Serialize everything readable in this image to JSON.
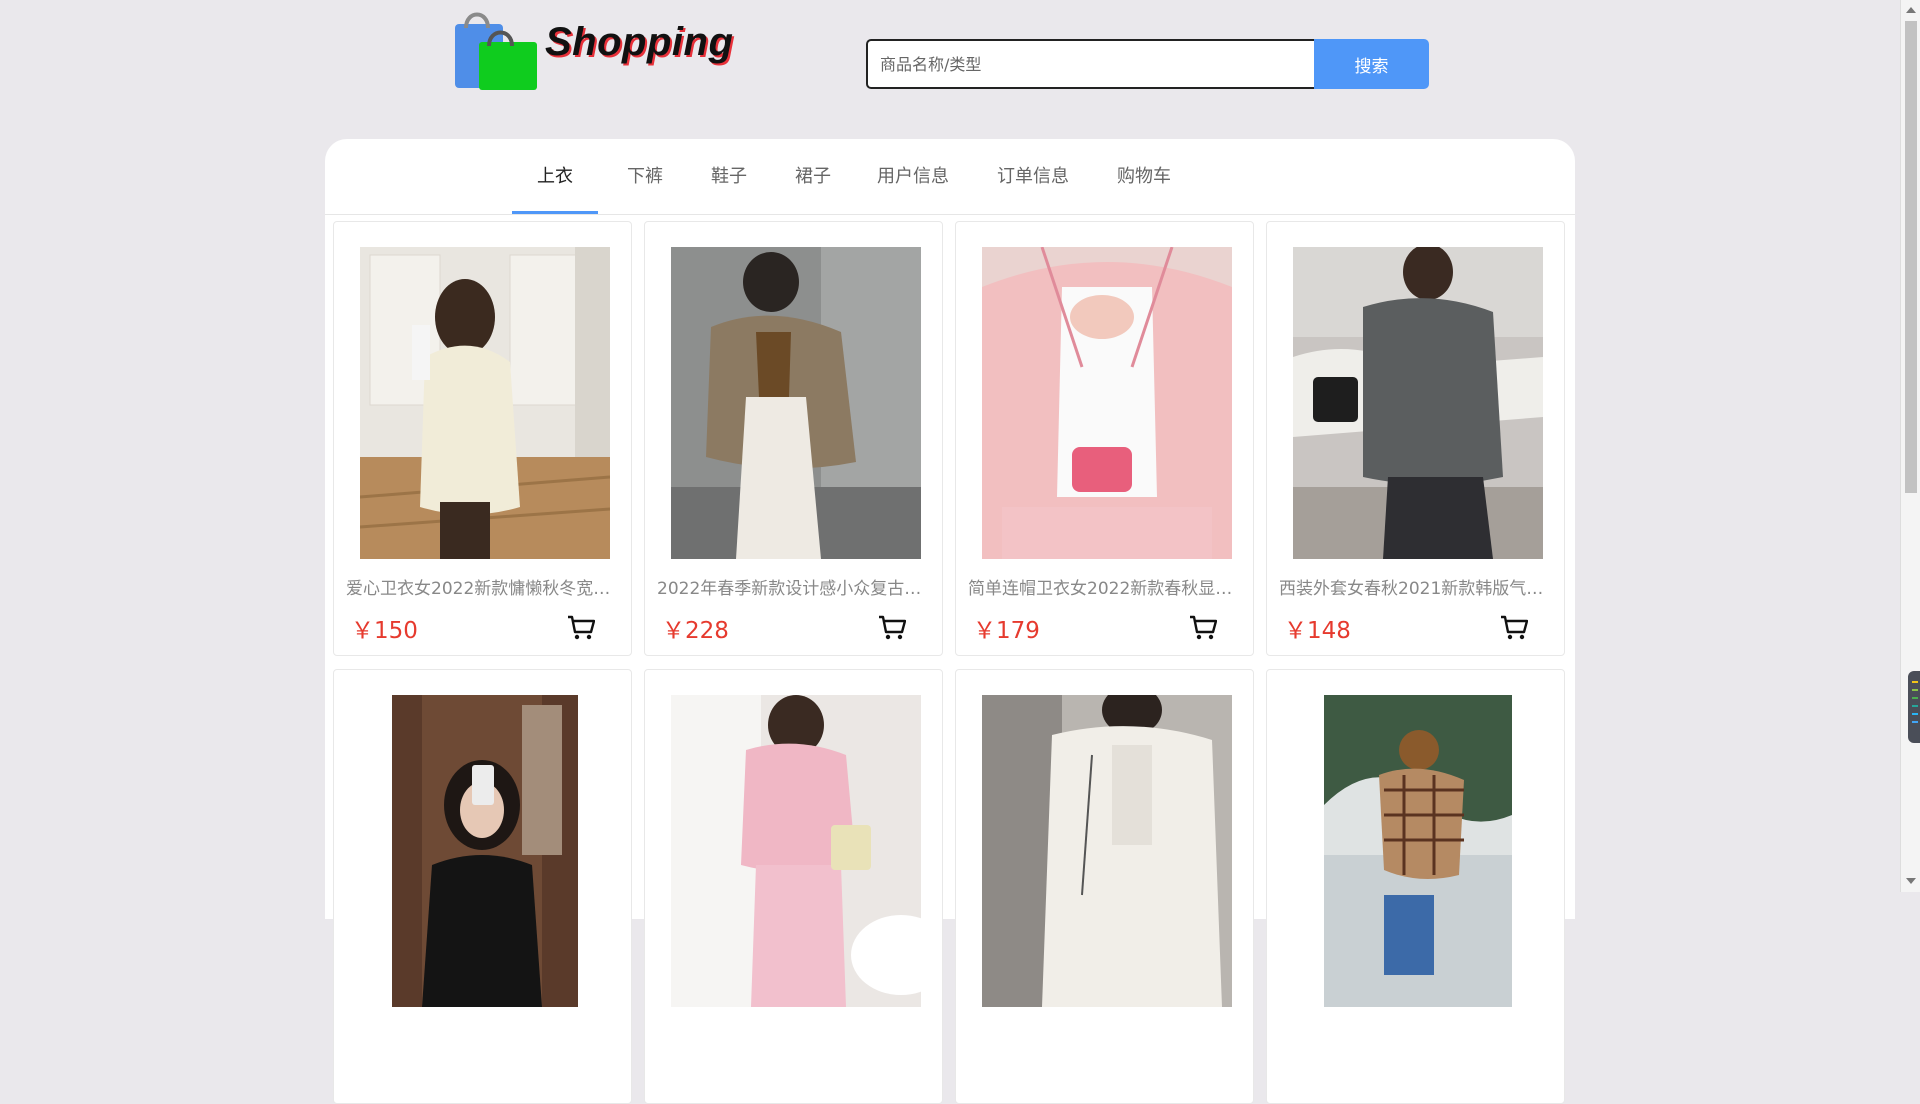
{
  "header": {
    "brand": "Shopping",
    "search_placeholder": "商品名称/类型",
    "search_button": "搜索"
  },
  "tabs": [
    "上衣",
    "下裤",
    "鞋子",
    "裙子",
    "用户信息",
    "订单信息",
    "购物车"
  ],
  "active_tab": "上衣",
  "products": [
    {
      "title": "爱心卫衣女2022新款慵懒秋冬宽松...",
      "price": "￥150"
    },
    {
      "title": "2022年春季新款设计感小众复古格...",
      "price": "￥228"
    },
    {
      "title": "简单连帽卫衣女2022新款春秋显瘦...",
      "price": "￥179"
    },
    {
      "title": "西装外套女春秋2021新款韩版气质...",
      "price": "￥148"
    },
    {
      "title": "",
      "price": ""
    },
    {
      "title": "",
      "price": ""
    },
    {
      "title": "",
      "price": ""
    },
    {
      "title": "",
      "price": ""
    }
  ],
  "colors": {
    "accent": "#4f97f8",
    "price": "#e63a2e",
    "background": "#eae8ec"
  }
}
